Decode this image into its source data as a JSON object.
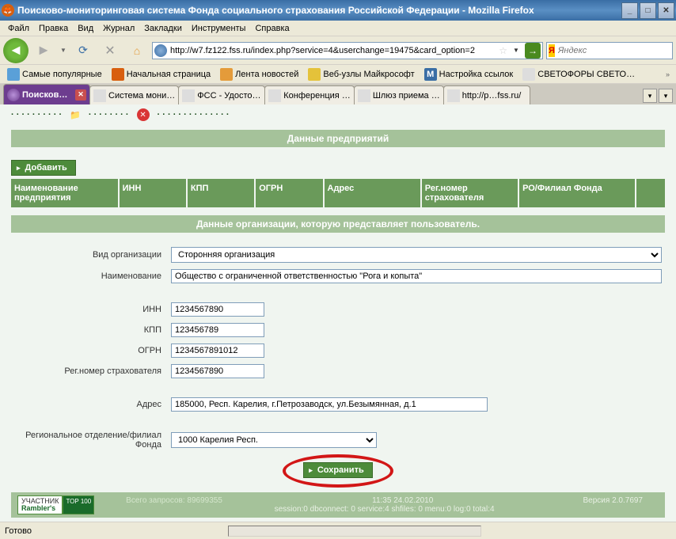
{
  "window": {
    "title": "Поисково-мониторинговая система Фонда социального страхования Российской Федерации - Mozilla Firefox"
  },
  "menu": [
    "Файл",
    "Правка",
    "Вид",
    "Журнал",
    "Закладки",
    "Инструменты",
    "Справка"
  ],
  "nav": {
    "url": "http://w7.fz122.fss.ru/index.php?service=4&userchange=19475&card_option=2",
    "search_placeholder": "Яндекс"
  },
  "bookmarks": [
    {
      "label": "Самые популярные",
      "color": "#5aa0d8"
    },
    {
      "label": "Начальная страница",
      "color": "#d85f0f"
    },
    {
      "label": "Лента новостей",
      "color": "#e49b3a"
    },
    {
      "label": "Веб-узлы Майкрософт",
      "color": "#e4c23a"
    },
    {
      "label": "Настройка ссылок",
      "color": "#3a6ea5"
    },
    {
      "label": "СВЕТОФОРЫ СВЕТО…",
      "color": "#ccc"
    }
  ],
  "tabs": [
    {
      "label": "Поисков…",
      "active": true
    },
    {
      "label": "Система мони…"
    },
    {
      "label": "ФСС - Удосто…"
    },
    {
      "label": "Конференция …"
    },
    {
      "label": "Шлюз приема …"
    },
    {
      "label": "http://p…fss.ru/"
    }
  ],
  "page": {
    "section_header": "Данные предприятий",
    "add_button": "Добавить",
    "columns": [
      "Наименование предприятия",
      "ИНН",
      "КПП",
      "ОГРН",
      "Адрес",
      "Рег.номер страхователя",
      "РО/Филиал Фонда",
      ""
    ],
    "sub_header": "Данные организации, которую представляет пользователь.",
    "fields": {
      "org_type": {
        "label": "Вид организации",
        "value": "Сторонняя организация"
      },
      "name": {
        "label": "Наименование",
        "value": "Общество с ограниченной ответственностью \"Рога и копыта\""
      },
      "inn": {
        "label": "ИНН",
        "value": "1234567890"
      },
      "kpp": {
        "label": "КПП",
        "value": "123456789"
      },
      "ogrn": {
        "label": "ОГРН",
        "value": "1234567891012"
      },
      "regnum": {
        "label": "Рег.номер страхователя",
        "value": "1234567890"
      },
      "address": {
        "label": "Адрес",
        "value": "185000, Респ. Карелия, г.Петрозаводск, ул.Безымянная, д.1"
      },
      "regional": {
        "label": "Региональное отделение/филиал Фонда",
        "value": "1000 Карелия Респ."
      }
    },
    "save_button": "Сохранить",
    "footer": {
      "rambler": "УЧАСТНИК",
      "rambler2": "Rambler's",
      "top100": "TOP 100",
      "requests": "Всего запросов: 89699355",
      "time": "11:35 24.02.2010",
      "version": "Версия 2.0.7697",
      "session": "session:0 dbconnect: 0 service:4 shfiles: 0 menu:0 log:0 total:4"
    }
  },
  "status": {
    "text": "Готово"
  }
}
